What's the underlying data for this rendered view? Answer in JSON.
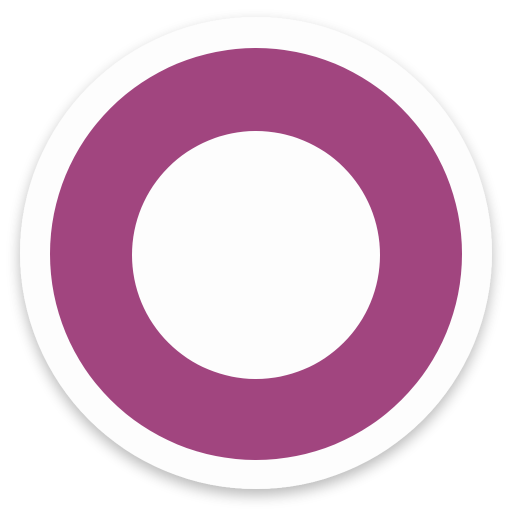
{
  "icon": {
    "name": "ring-logo-icon",
    "colors": {
      "ring": "#a1457f",
      "badge": "#fdfdfd",
      "center": "#fdfdfd",
      "shadow": "#000000"
    }
  }
}
